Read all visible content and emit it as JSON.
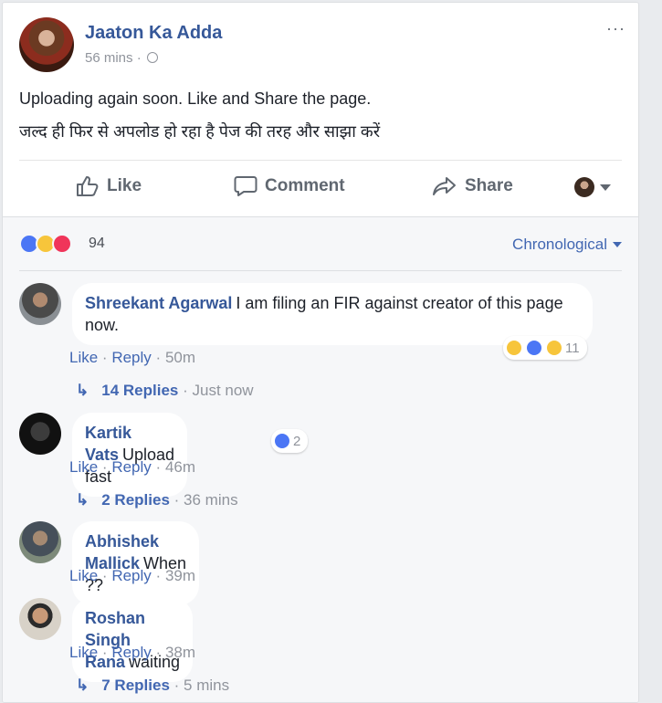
{
  "post": {
    "page_name": "Jaaton Ka Adda",
    "time": "56 mins",
    "meta_sep": "·",
    "text_line1": "Uploading again soon. Like and Share the page.",
    "text_line2": "जल्द ही फिर से अपलोड हो रहा है पेज की तरह और साझा करें",
    "more_label": "···"
  },
  "actions": {
    "like": "Like",
    "comment": "Comment",
    "share": "Share"
  },
  "reactions": {
    "count": "94",
    "icons": [
      "like-icon",
      "haha-icon",
      "love-icon"
    ],
    "order_label": "Chronological"
  },
  "comments": [
    {
      "author": "Shreekant Agarwal",
      "text": "I am filing an FIR against creator of this page now.",
      "like": "Like",
      "reply": "Reply",
      "time": "50m",
      "reaction_count": "11",
      "reaction_icons": [
        "haha-icon",
        "like-icon",
        "wow-icon"
      ],
      "replies_label": "14 Replies",
      "replies_time": "Just now"
    },
    {
      "author": "Kartik Vats",
      "text": "Upload fast",
      "like": "Like",
      "reply": "Reply",
      "time": "46m",
      "reaction_count": "2",
      "reaction_icons": [
        "like-icon"
      ],
      "replies_label": "2 Replies",
      "replies_time": "36 mins"
    },
    {
      "author": "Abhishek Mallick",
      "text": "When ??",
      "like": "Like",
      "reply": "Reply",
      "time": "39m"
    },
    {
      "author": "Roshan Singh Rana",
      "text": "waiting",
      "like": "Like",
      "reply": "Reply",
      "time": "38m",
      "replies_label": "7 Replies",
      "replies_time": "5 mins"
    }
  ],
  "separator": "·",
  "colors": {
    "link": "#365899",
    "accent": "#4267b2",
    "muted": "#90949c"
  }
}
